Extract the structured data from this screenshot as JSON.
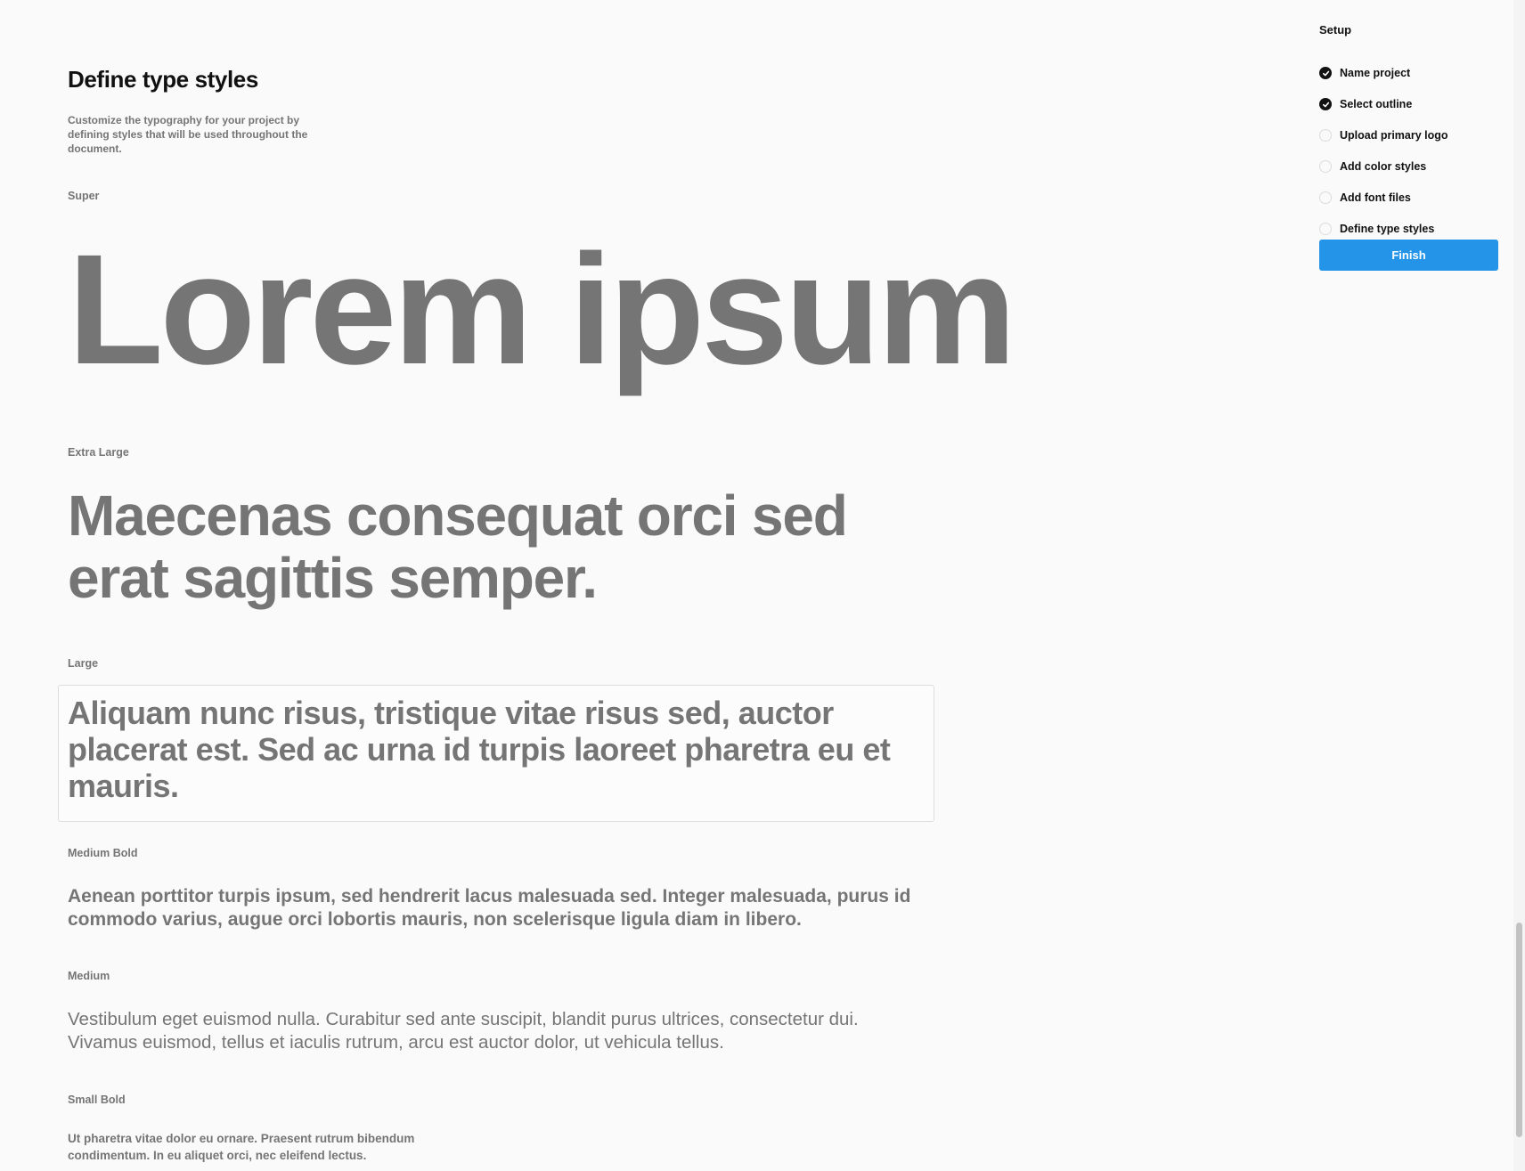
{
  "page": {
    "title": "Define type styles",
    "description": "Customize the typography for your project by defining styles that will be used throughout the document."
  },
  "type_styles": [
    {
      "label": "Super",
      "sample": "Lorem ipsum"
    },
    {
      "label": "Extra Large",
      "sample": "Maecenas consequat orci sed erat sagittis semper."
    },
    {
      "label": "Large",
      "sample": "Aliquam nunc risus, tristique vitae risus sed, auctor placerat est. Sed ac urna id turpis laoreet pharetra eu et mauris."
    },
    {
      "label": "Medium Bold",
      "sample": "Aenean porttitor turpis ipsum, sed hendrerit lacus malesuada sed. Integer malesuada, purus id commodo varius, augue orci lobortis mauris, non scelerisque ligula diam in libero."
    },
    {
      "label": "Medium",
      "sample": "Vestibulum eget euismod nulla. Curabitur sed ante suscipit, blandit purus ultrices, consectetur dui. Vivamus euismod, tellus et iaculis rutrum, arcu est auctor dolor, ut vehicula tellus."
    },
    {
      "label": "Small Bold",
      "sample": "Ut pharetra vitae dolor eu ornare. Praesent rutrum bibendum condimentum. In eu aliquet orci, nec eleifend lectus."
    }
  ],
  "setup": {
    "title": "Setup",
    "steps": [
      {
        "label": "Name project",
        "completed": true,
        "icon": "check-circle-icon"
      },
      {
        "label": "Select outline",
        "completed": true,
        "icon": "check-circle-icon"
      },
      {
        "label": "Upload primary logo",
        "completed": false,
        "icon": "empty-circle-icon"
      },
      {
        "label": "Add color styles",
        "completed": false,
        "icon": "empty-circle-icon"
      },
      {
        "label": "Add font files",
        "completed": false,
        "icon": "empty-circle-icon"
      },
      {
        "label": "Define type styles",
        "completed": false,
        "icon": "empty-circle-icon"
      }
    ],
    "finish_label": "Finish"
  },
  "colors": {
    "accent": "#2394e8",
    "text_primary": "#111111",
    "text_secondary": "#757575",
    "background": "#fafafa"
  }
}
